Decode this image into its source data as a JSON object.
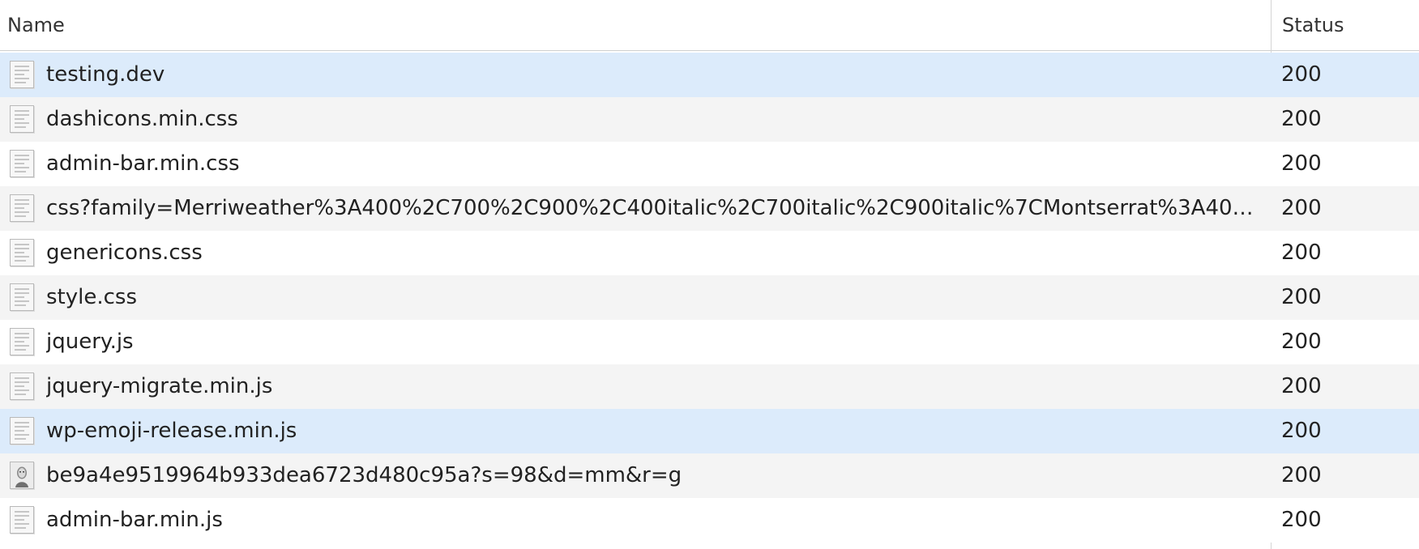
{
  "columns": {
    "name": "Name",
    "status": "Status"
  },
  "requests": [
    {
      "name": "testing.dev",
      "status": "200",
      "icon": "document-icon",
      "selected": true
    },
    {
      "name": "dashicons.min.css",
      "status": "200",
      "icon": "document-icon"
    },
    {
      "name": "admin-bar.min.css",
      "status": "200",
      "icon": "document-icon"
    },
    {
      "name": "css?family=Merriweather%3A400%2C700%2C900%2C400italic%2C700italic%2C900italic%7CMontserrat%3A400%2C...",
      "status": "200",
      "icon": "document-icon"
    },
    {
      "name": "genericons.css",
      "status": "200",
      "icon": "document-icon"
    },
    {
      "name": "style.css",
      "status": "200",
      "icon": "document-icon"
    },
    {
      "name": "jquery.js",
      "status": "200",
      "icon": "document-icon"
    },
    {
      "name": "jquery-migrate.min.js",
      "status": "200",
      "icon": "document-icon"
    },
    {
      "name": "wp-emoji-release.min.js",
      "status": "200",
      "icon": "document-icon",
      "selected": true
    },
    {
      "name": "be9a4e9519964b933dea6723d480c95a?s=98&d=mm&r=g",
      "status": "200",
      "icon": "avatar-image-icon"
    },
    {
      "name": "admin-bar.min.js",
      "status": "200",
      "icon": "document-icon"
    }
  ],
  "colors": {
    "selected_row": "#dcebfb",
    "alternate_row": "#f4f4f4"
  }
}
